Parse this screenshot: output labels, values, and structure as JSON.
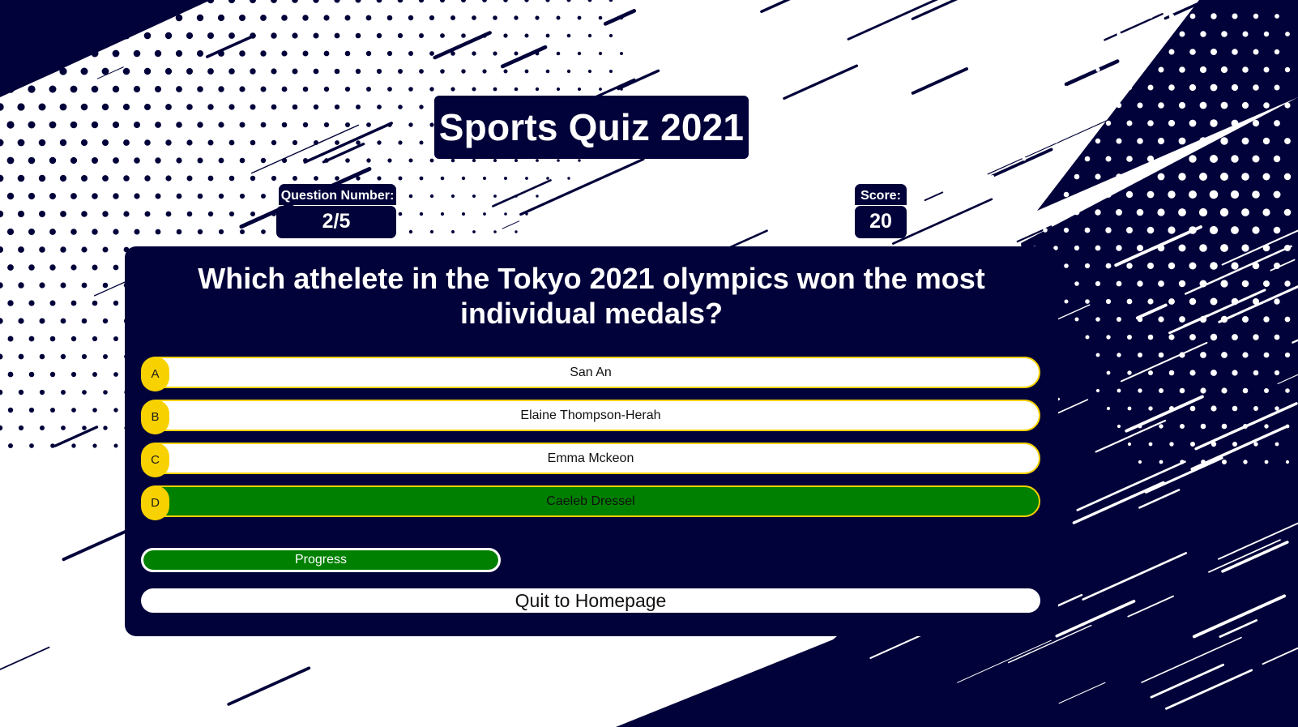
{
  "title": "Sports Quiz 2021",
  "stats": {
    "question_number_label": "Question Number:",
    "question_number_value": "2/5",
    "score_label": "Score:",
    "score_value": "20"
  },
  "question": "Which athelete in the Tokyo 2021 olympics won the most individual medals?",
  "answers": [
    {
      "letter": "A",
      "text": "San An",
      "state": "default"
    },
    {
      "letter": "B",
      "text": "Elaine Thompson-Herah",
      "state": "default"
    },
    {
      "letter": "C",
      "text": "Emma Mckeon",
      "state": "default"
    },
    {
      "letter": "D",
      "text": "Caeleb Dressel",
      "state": "correct"
    }
  ],
  "progress": {
    "label": "Progress",
    "fraction": 0.4
  },
  "quit_label": "Quit to Homepage",
  "colors": {
    "navy": "#02023a",
    "accent_yellow": "#f7d200",
    "correct_green": "#008000",
    "white": "#ffffff"
  }
}
